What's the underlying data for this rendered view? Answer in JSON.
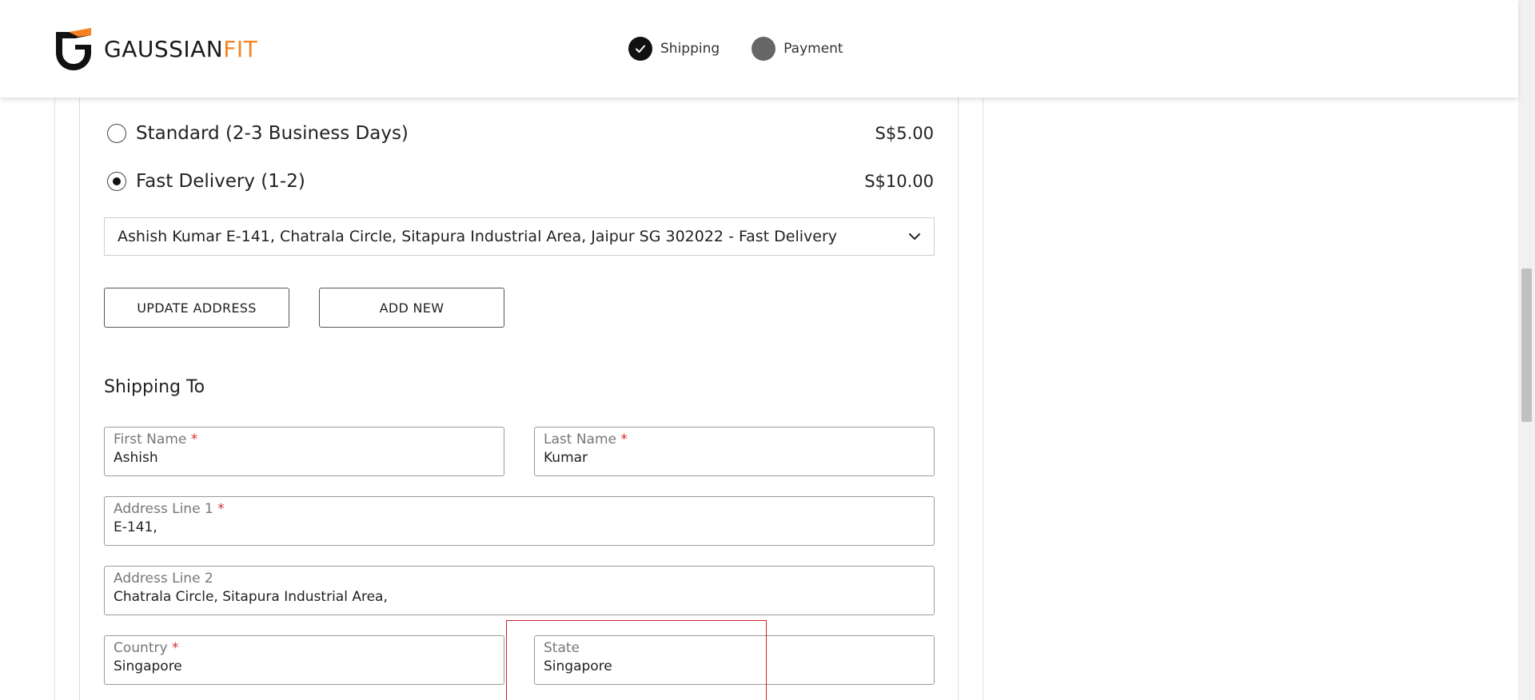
{
  "brand": {
    "name_a": "GAUSSIAN",
    "name_b": "FIT",
    "accent": "#f5821f"
  },
  "steps": [
    {
      "label": "Shipping",
      "status": "done"
    },
    {
      "label": "Payment",
      "status": "todo"
    }
  ],
  "shipping_options": [
    {
      "label": "Standard (2-3 Business Days)",
      "price": "S$5.00",
      "selected": false
    },
    {
      "label": "Fast Delivery (1-2)",
      "price": "S$10.00",
      "selected": true
    }
  ],
  "address_select": {
    "value": "Ashish Kumar E-141, Chatrala Circle, Sitapura Industrial Area, Jaipur SG 302022 - Fast Delivery"
  },
  "buttons": {
    "update": "UPDATE ADDRESS",
    "add_new": "ADD NEW"
  },
  "shipping_to": {
    "title": "Shipping To",
    "first_name": {
      "label": "First Name",
      "required": "*",
      "value": "Ashish"
    },
    "last_name": {
      "label": "Last Name",
      "required": "*",
      "value": "Kumar"
    },
    "address1": {
      "label": "Address Line 1",
      "required": "*",
      "value": "E-141,"
    },
    "address2": {
      "label": "Address Line 2",
      "value": "Chatrala Circle, Sitapura Industrial Area,"
    },
    "country": {
      "label": "Country",
      "required": "*",
      "value": "Singapore"
    },
    "state": {
      "label": "State",
      "value": "Singapore"
    }
  },
  "highlight_color": "#d2232a"
}
